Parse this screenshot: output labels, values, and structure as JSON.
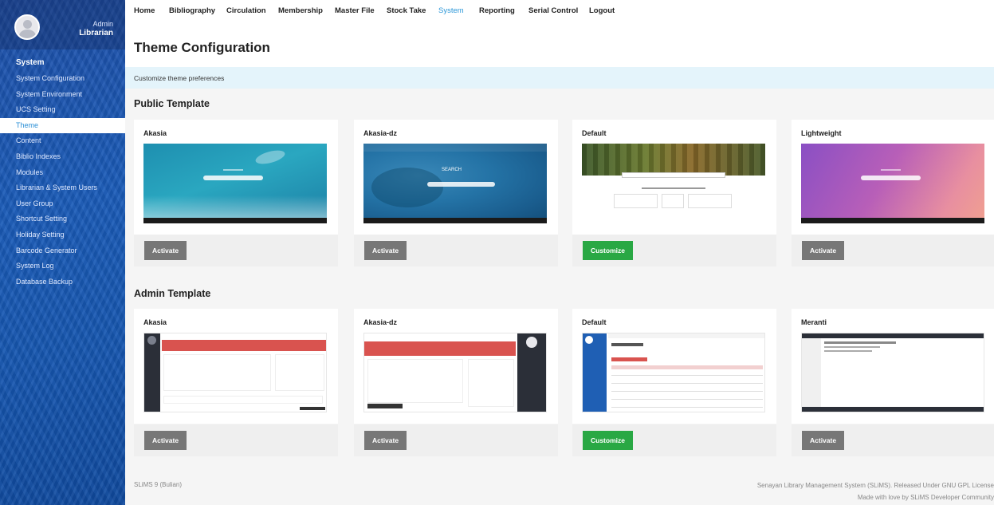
{
  "sidebar": {
    "profile_name": "Admin",
    "profile_role": "Librarian",
    "menu_heading": "System",
    "items": [
      {
        "label": "System Configuration"
      },
      {
        "label": "System Environment"
      },
      {
        "label": "UCS Setting"
      },
      {
        "label": "Theme",
        "active": true
      },
      {
        "label": "Content"
      },
      {
        "label": "Biblio Indexes"
      },
      {
        "label": "Modules"
      },
      {
        "label": "Librarian & System Users"
      },
      {
        "label": "User Group"
      },
      {
        "label": "Shortcut Setting"
      },
      {
        "label": "Holiday Setting"
      },
      {
        "label": "Barcode Generator"
      },
      {
        "label": "System Log"
      },
      {
        "label": "Database Backup"
      }
    ]
  },
  "nav": {
    "items": [
      "Home",
      "Bibliography",
      "Circulation",
      "Membership",
      "Master File",
      "Stock Take",
      "System",
      "Reporting",
      "Serial Control",
      "Logout"
    ],
    "active": "System"
  },
  "page": {
    "title": "Theme Configuration",
    "info": "Customize theme preferences"
  },
  "public_template": {
    "heading": "Public Template",
    "cards": [
      {
        "name": "Akasia",
        "button": "Activate"
      },
      {
        "name": "Akasia-dz",
        "button": "Activate"
      },
      {
        "name": "Default",
        "button": "Customize"
      },
      {
        "name": "Lightweight",
        "button": "Activate"
      }
    ]
  },
  "admin_template": {
    "heading": "Admin Template",
    "cards": [
      {
        "name": "Akasia",
        "button": "Activate"
      },
      {
        "name": "Akasia-dz",
        "button": "Activate"
      },
      {
        "name": "Default",
        "button": "Customize"
      },
      {
        "name": "Meranti",
        "button": "Activate"
      }
    ]
  },
  "thumbnails": {
    "search_word": "SEARCH"
  },
  "footer": {
    "version": "SLiMS 9 (Bulian)",
    "line1": "Senayan Library Management System (SLiMS). Released Under GNU GPL License",
    "line2": "Made with love by SLiMS Developer Community"
  },
  "colors": {
    "sidebar": "#1a5bb8",
    "active_link": "#2b97d8",
    "button_gray": "#777777",
    "button_green": "#29a844",
    "info_bar": "#e4f4fb"
  }
}
